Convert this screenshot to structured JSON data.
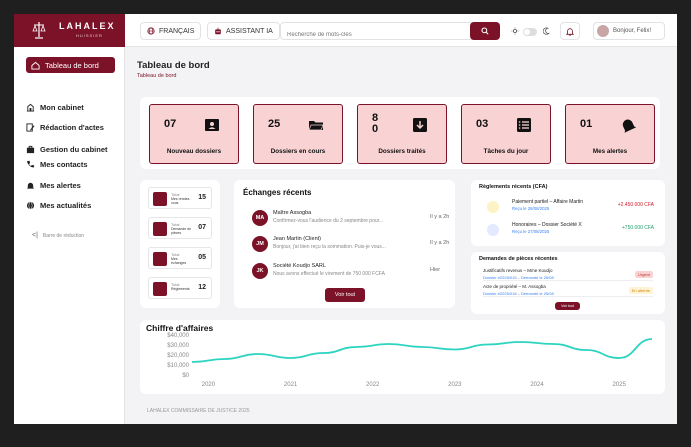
{
  "header": {
    "brand": "LAHALEX",
    "brand_sub": "HUISSIER",
    "lang": "FRANÇAIS",
    "assistant": "ASSISTANT IA",
    "search_placeholder": "Recherche de mots-clés",
    "user_greeting": "Bonjour, Felix!",
    "accent": "#7b1228"
  },
  "sidebar": {
    "items": [
      {
        "label": "Tableau de bord",
        "icon": "home-icon"
      },
      {
        "label": "Mon cabinet",
        "icon": "building-icon"
      },
      {
        "label": "Rédaction d'actes",
        "icon": "document-edit-icon"
      },
      {
        "label": "Gestion du cabinet",
        "icon": "briefcase-icon"
      },
      {
        "label": "Mes contacts",
        "icon": "phone-icon"
      },
      {
        "label": "Mes alertes",
        "icon": "bell-icon"
      },
      {
        "label": "Mes actualités",
        "icon": "globe-icon"
      }
    ],
    "collapse": "Barre de réduction"
  },
  "page": {
    "title": "Tableau de bord",
    "breadcrumb": "Tableau de bord"
  },
  "stats": [
    {
      "value": "07",
      "label": "Nouveau dossiers",
      "icon": "id-card-icon"
    },
    {
      "value": "25",
      "label": "Dossiers en cours",
      "icon": "folder-open-icon"
    },
    {
      "value": "8\n0",
      "label": "Dossiers traités",
      "icon": "download-box-icon"
    },
    {
      "value": "03",
      "label": "Tâches du jour",
      "icon": "checklist-icon"
    },
    {
      "value": "01",
      "label": "Mes alertes",
      "icon": "bell-icon"
    }
  ],
  "mini_stats": [
    {
      "top": "Total",
      "sub": "Mes rendez-vous",
      "value": "15"
    },
    {
      "top": "Total",
      "sub": "Demande de pièces",
      "value": "07"
    },
    {
      "top": "Total",
      "sub": "Mes échanges",
      "value": "05"
    },
    {
      "top": "Total",
      "sub": "Règlements",
      "value": "12"
    }
  ],
  "exchanges": {
    "title": "Échanges récents",
    "items": [
      {
        "initials": "MA",
        "name": "Maître Assogba",
        "text": "Confirmez-vous l'audience du 2 septembre pour...",
        "when": "Il y a 2h"
      },
      {
        "initials": "JM",
        "name": "Jean Martin (Client)",
        "text": "Bonjour, j'ai bien reçu la sommation. Puis-je vous...",
        "when": "Il y a 2h"
      },
      {
        "initials": "JK",
        "name": "Société Koudjo SARL",
        "text": "Nous avons effectué le virement de 750 000 FCFA",
        "when": "Hier"
      }
    ],
    "button": "Voir tout"
  },
  "payments": {
    "title": "Règlements récents (CFA)",
    "items": [
      {
        "label": "Paiement partiel – Affaire Martin",
        "date": "Reçu le 28/08/2025",
        "amount": "+2.450.000 CFA",
        "color": "#d11a2a",
        "icon_bg": "#fdf3c4"
      },
      {
        "label": "Honoraires – Dossier Société X",
        "date": "Reçu le 27/08/2025",
        "amount": "+750.000 CFA",
        "color": "#22a06b",
        "icon_bg": "#e3e9ff"
      }
    ]
  },
  "documents": {
    "title": "Demandes de pièces récentes",
    "items": [
      {
        "label": "Justificatifs revenus – Mme Koudjo",
        "ref": "Dossier #2025/015 – Demandé le 26/08",
        "tag": "Urgent",
        "tag_bg": "#f9d2d4",
        "tag_color": "#c0392b"
      },
      {
        "label": "Acte de propriété – M. Assogba",
        "ref": "Dossier #2025/018 – Demandé le 25/08",
        "tag": "En attente",
        "tag_bg": "#fff3d6",
        "tag_color": "#d68910"
      }
    ],
    "button": "Voir tout"
  },
  "revenue": {
    "title": "Chiffre d'affaires"
  },
  "chart_data": {
    "type": "line",
    "title": "Chiffre d'affaires",
    "x": [
      2019.8,
      2020.2,
      2020.6,
      2021.0,
      2021.4,
      2021.8,
      2022.2,
      2022.6,
      2023.0,
      2023.4,
      2023.8,
      2024.2,
      2024.6,
      2025.0,
      2025.4
    ],
    "series": [
      {
        "values": [
          13000,
          16000,
          21000,
          17000,
          22000,
          28000,
          31000,
          28000,
          25500,
          30500,
          33000,
          31000,
          25000,
          17000,
          36000
        ],
        "color": "#2dd4c0"
      }
    ],
    "xticks": [
      "2020",
      "2021",
      "2022",
      "2023",
      "2024",
      "2025"
    ],
    "yticks": [
      "$40,000",
      "$30,000",
      "$20,000",
      "$10,000",
      "$0"
    ],
    "ylim": [
      0,
      40000
    ]
  },
  "footer": "LAHALEX COMMISSAIRE DE JUSTICE 2025"
}
